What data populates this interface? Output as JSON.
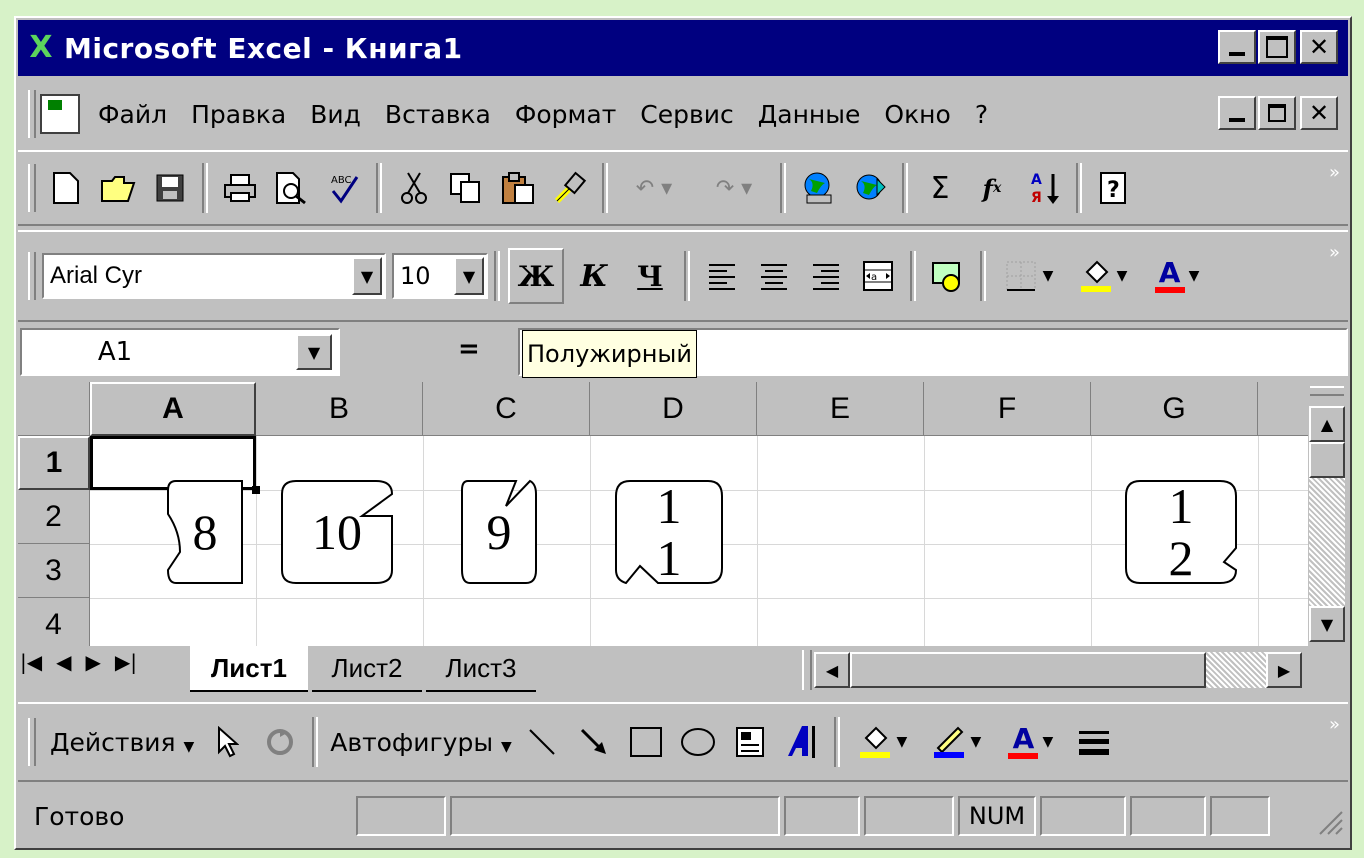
{
  "window": {
    "title": "Microsoft Excel - Книга1",
    "app_icon": "excel-icon"
  },
  "menu": [
    "Файл",
    "Правка",
    "Вид",
    "Вставка",
    "Формат",
    "Сервис",
    "Данные",
    "Окно",
    "?"
  ],
  "font_combo": {
    "font": "Arial Cyr",
    "size": "10"
  },
  "format_buttons": {
    "bold": "Ж",
    "italic": "К",
    "underline": "Ч",
    "font_color_letter": "А"
  },
  "formula_bar": {
    "cell": "A1",
    "equals": "=",
    "tooltip": "Полужирный"
  },
  "columns": [
    "A",
    "B",
    "C",
    "D",
    "E",
    "F",
    "G"
  ],
  "rows": [
    "1",
    "2",
    "3",
    "4"
  ],
  "callouts": [
    {
      "col": "A",
      "text": "8"
    },
    {
      "col": "B",
      "text": "10"
    },
    {
      "col": "C",
      "text": "9"
    },
    {
      "col": "D",
      "line1": "1",
      "line2": "1"
    },
    {
      "col": "G",
      "line1": "1",
      "line2": "2"
    }
  ],
  "sheets": [
    "Лист1",
    "Лист2",
    "Лист3"
  ],
  "drawing": {
    "actions": "Действия",
    "autoshapes": "Автофигуры",
    "font_color_letter": "А"
  },
  "status": {
    "ready": "Готово",
    "num": "NUM"
  },
  "colors": {
    "title_bg": "#000080",
    "face": "#c0c0c0",
    "highlight_yellow": "#ffff00",
    "font_red": "#ff0000",
    "line_blue": "#0000ff"
  }
}
